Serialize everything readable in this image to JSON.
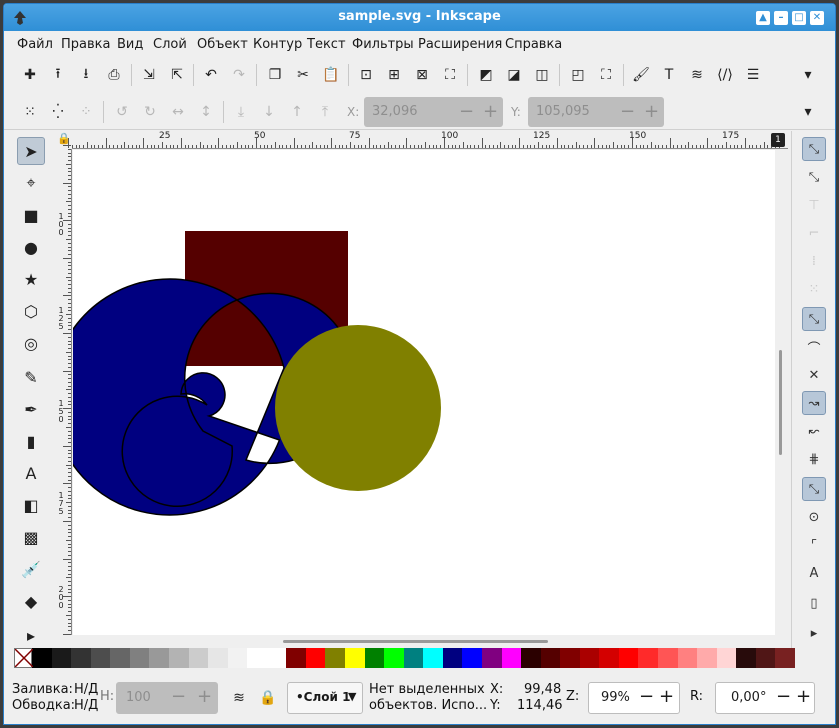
{
  "window": {
    "title": "sample.svg - Inkscape"
  },
  "menu": [
    "Файл",
    "Правка",
    "Вид",
    "Слой",
    "Объект",
    "Контур",
    "Текст",
    "Фильтры",
    "Расширения",
    "Справка"
  ],
  "toolbar2": {
    "x_label": "X:",
    "x_value": "32,096",
    "y_label": "Y:",
    "y_value": "105,095"
  },
  "ruler": {
    "h_labels": [
      "25",
      "50",
      "75",
      "100",
      "125",
      "150",
      "175"
    ],
    "v_labels": [
      "100",
      "125",
      "150",
      "175",
      "200"
    ],
    "page_indicator": "1"
  },
  "colors": {
    "square": "#550000",
    "spiral": "#000080",
    "circle": "#808000",
    "accent": "#2f8fd6"
  },
  "palette": [
    "#000000",
    "#1a1a1a",
    "#333333",
    "#4d4d4d",
    "#666666",
    "#808080",
    "#999999",
    "#b3b3b3",
    "#cccccc",
    "#e6e6e6",
    "#f2f2f2",
    "#ffffff",
    "#ffffff",
    "#800000",
    "#ff0000",
    "#808000",
    "#ffff00",
    "#008000",
    "#00ff00",
    "#008080",
    "#00ffff",
    "#000080",
    "#0000ff",
    "#800080",
    "#ff00ff",
    "#2b0000",
    "#550000",
    "#800000",
    "#aa0000",
    "#d40000",
    "#ff0000",
    "#ff2a2a",
    "#ff5555",
    "#ff8080",
    "#ffaaaa",
    "#ffd5d5",
    "#280b0b",
    "#501616",
    "#782121"
  ],
  "status": {
    "fill_label": "Заливка:",
    "fill_value": "Н/Д",
    "stroke_label": "Обводка:",
    "stroke_value": "Н/Д",
    "h_label": "H:",
    "opacity_value": "100",
    "layer": "•Слой 1",
    "message_line1": "Нет выделенных",
    "message_line2": "объектов. Испо...",
    "cursor_x_label": "X:",
    "cursor_x": "99,48",
    "cursor_y_label": "Y:",
    "cursor_y": "114,46",
    "zoom_label": "Z:",
    "zoom": "99%",
    "rotate_label": "R:",
    "rotate": "0,00°"
  }
}
